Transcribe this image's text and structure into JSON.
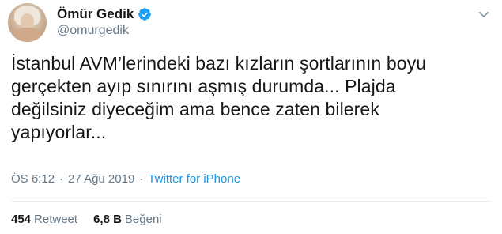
{
  "author": {
    "name": "Ömür Gedik",
    "handle": "@omurgedik",
    "verified": true,
    "avatar_icon": "profile-photo"
  },
  "tweet": {
    "lines": [
      "İstanbul AVM’lerindeki bazı kızların şortlarının boyu",
      "gerçekten ayıp sınırını aşmış durumda... Plajda",
      "değilsiniz diyeceğim ama bence zaten bilerek",
      "yapıyorlar..."
    ]
  },
  "meta": {
    "time": "ÖS 6:12",
    "separator": "·",
    "date": "27 Ağu 2019",
    "source": "Twitter for iPhone"
  },
  "stats": {
    "retweets_count": "454",
    "retweets_label": "Retweet",
    "likes_count": "6,8 B",
    "likes_label": "Beğeni"
  },
  "colors": {
    "link": "#1b95e0",
    "verified": "#1da1f2",
    "muted": "#657786",
    "text": "#14171a"
  }
}
